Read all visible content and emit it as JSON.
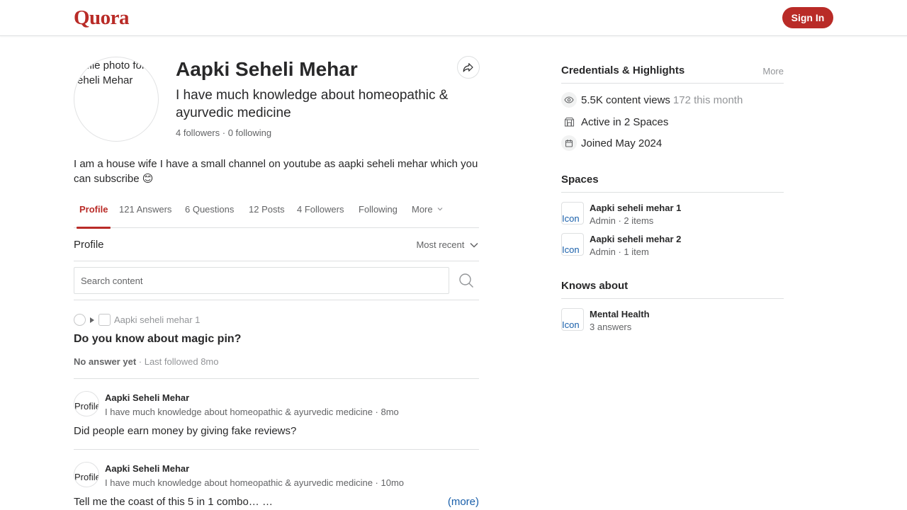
{
  "header": {
    "logo": "Quora",
    "signin_label": "Sign In"
  },
  "profile": {
    "avatar_alt": "Profile photo for Aapki Seheli Mehar",
    "name": "Aapki Seheli Mehar",
    "headline": "I have much knowledge about homeopathic & ayurvedic medicine",
    "follow_line": "4 followers · 0 following",
    "bio": "I am a house wife I have a small channel on youtube as aapki seheli mehar which you can subscribe 😊"
  },
  "tabs": [
    {
      "label": "Profile"
    },
    {
      "label": "121 Answers"
    },
    {
      "label": "6 Questions"
    },
    {
      "label": "12 Posts"
    },
    {
      "label": "4 Followers"
    },
    {
      "label": "Following"
    },
    {
      "label": "More"
    }
  ],
  "section": {
    "title": "Profile",
    "sort_label": "Most recent"
  },
  "search": {
    "placeholder": "Search content"
  },
  "feed": {
    "question": {
      "space": "Aapki seheli mehar 1",
      "title": "Do you know about magic pin?",
      "no_answer": "No answer yet",
      "meta": " · Last followed 8mo"
    },
    "answers": [
      {
        "avatar_alt": "Profile",
        "name": "Aapki Seheli Mehar",
        "sub": "I have much knowledge about homeopathic & ayurvedic medicine · 8mo",
        "text": "Did people earn money by giving fake reviews?"
      },
      {
        "avatar_alt": "Profile",
        "name": "Aapki Seheli Mehar",
        "sub": "I have much knowledge about homeopathic & ayurvedic medicine · 10mo",
        "text": "Tell me the coast of this 5 in 1 combo… …",
        "more": "(more)"
      }
    ]
  },
  "sidebar": {
    "credentials": {
      "title": "Credentials & Highlights",
      "more": "More",
      "views": "5.5K content views",
      "views_month": "172 this month",
      "spaces": "Active in 2 Spaces",
      "joined": "Joined May 2024"
    },
    "spaces": {
      "title": "Spaces",
      "items": [
        {
          "icon_alt": "Icon",
          "name": "Aapki seheli mehar 1",
          "sub": "Admin · 2 items"
        },
        {
          "icon_alt": "Icon",
          "name": "Aapki seheli mehar 2",
          "sub": "Admin · 1 item"
        }
      ]
    },
    "knows": {
      "title": "Knows about",
      "items": [
        {
          "icon_alt": "Icon",
          "name": "Mental Health",
          "sub": "3 answers"
        }
      ]
    }
  },
  "colors": {
    "brand": "#b92b27",
    "link": "#195faa"
  }
}
